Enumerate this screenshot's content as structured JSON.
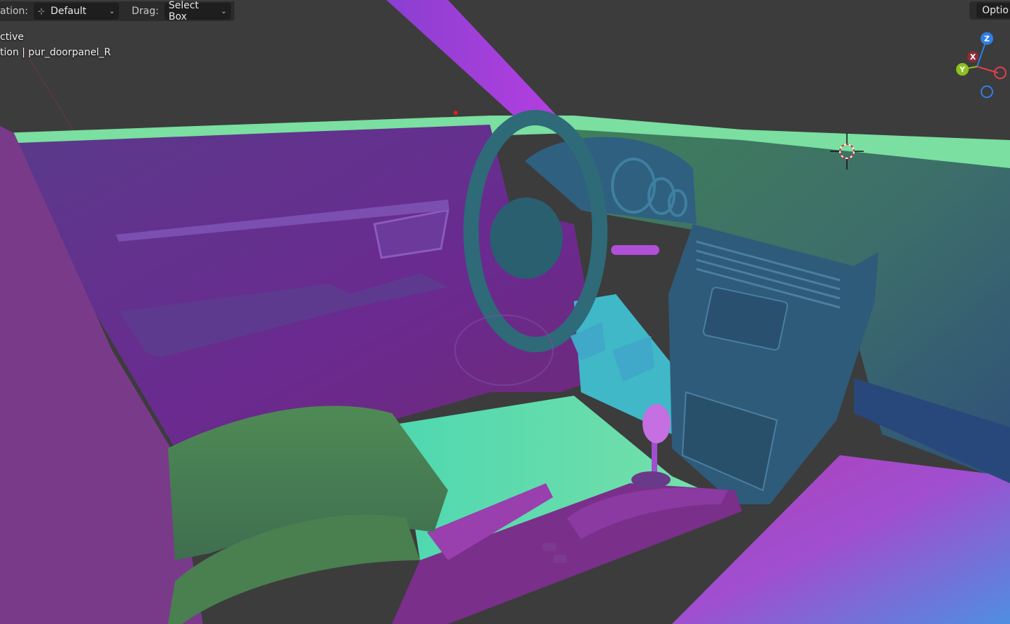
{
  "header": {
    "orientation_label": "ation:",
    "orientation_value": "Default",
    "drag_label": "Drag:",
    "drag_value": "Select Box",
    "options_label": "Optio"
  },
  "overlay": {
    "line1": "ctive",
    "line2": "tion | pur_doorpanel_R"
  },
  "gizmo": {
    "z_label": "Z",
    "x_label": "X",
    "y_label": "Y",
    "colors": {
      "z": "#2f7fe6",
      "x": "#e0414f",
      "y": "#8bc21c"
    }
  },
  "scene_colors": {
    "background": "#3c3c3c",
    "purple": "#7a2fa0",
    "teal": "#2f6e7a",
    "green": "#4f8f5a",
    "mint": "#6fe0a8",
    "magenta": "#c23fbd"
  }
}
